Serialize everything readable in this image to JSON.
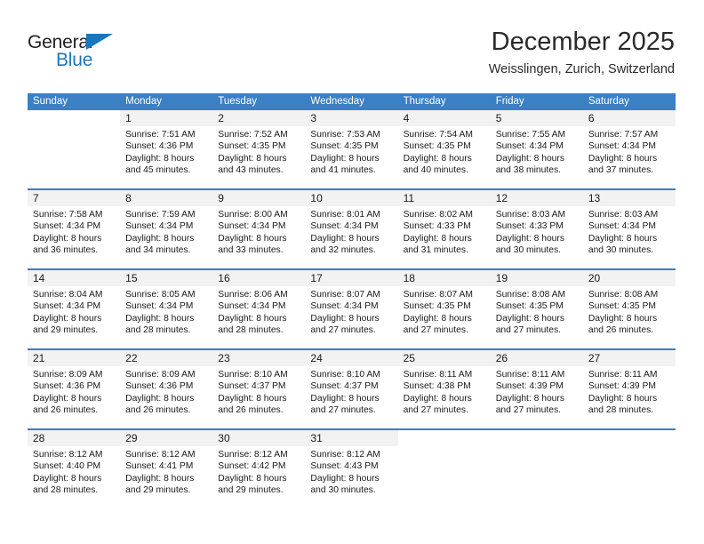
{
  "brand": {
    "name_part1": "General",
    "name_part2": "Blue",
    "triangle_color": "#1b76bc"
  },
  "header": {
    "title": "December 2025",
    "subtitle": "Weisslingen, Zurich, Switzerland"
  },
  "calendar": {
    "header_color": "#3b7fc4",
    "weekdays": [
      "Sunday",
      "Monday",
      "Tuesday",
      "Wednesday",
      "Thursday",
      "Friday",
      "Saturday"
    ],
    "weeks": [
      [
        {
          "day": ""
        },
        {
          "day": "1",
          "sunrise": "Sunrise: 7:51 AM",
          "sunset": "Sunset: 4:36 PM",
          "daylight_line1": "Daylight: 8 hours",
          "daylight_line2": "and 45 minutes."
        },
        {
          "day": "2",
          "sunrise": "Sunrise: 7:52 AM",
          "sunset": "Sunset: 4:35 PM",
          "daylight_line1": "Daylight: 8 hours",
          "daylight_line2": "and 43 minutes."
        },
        {
          "day": "3",
          "sunrise": "Sunrise: 7:53 AM",
          "sunset": "Sunset: 4:35 PM",
          "daylight_line1": "Daylight: 8 hours",
          "daylight_line2": "and 41 minutes."
        },
        {
          "day": "4",
          "sunrise": "Sunrise: 7:54 AM",
          "sunset": "Sunset: 4:35 PM",
          "daylight_line1": "Daylight: 8 hours",
          "daylight_line2": "and 40 minutes."
        },
        {
          "day": "5",
          "sunrise": "Sunrise: 7:55 AM",
          "sunset": "Sunset: 4:34 PM",
          "daylight_line1": "Daylight: 8 hours",
          "daylight_line2": "and 38 minutes."
        },
        {
          "day": "6",
          "sunrise": "Sunrise: 7:57 AM",
          "sunset": "Sunset: 4:34 PM",
          "daylight_line1": "Daylight: 8 hours",
          "daylight_line2": "and 37 minutes."
        }
      ],
      [
        {
          "day": "7",
          "sunrise": "Sunrise: 7:58 AM",
          "sunset": "Sunset: 4:34 PM",
          "daylight_line1": "Daylight: 8 hours",
          "daylight_line2": "and 36 minutes."
        },
        {
          "day": "8",
          "sunrise": "Sunrise: 7:59 AM",
          "sunset": "Sunset: 4:34 PM",
          "daylight_line1": "Daylight: 8 hours",
          "daylight_line2": "and 34 minutes."
        },
        {
          "day": "9",
          "sunrise": "Sunrise: 8:00 AM",
          "sunset": "Sunset: 4:34 PM",
          "daylight_line1": "Daylight: 8 hours",
          "daylight_line2": "and 33 minutes."
        },
        {
          "day": "10",
          "sunrise": "Sunrise: 8:01 AM",
          "sunset": "Sunset: 4:34 PM",
          "daylight_line1": "Daylight: 8 hours",
          "daylight_line2": "and 32 minutes."
        },
        {
          "day": "11",
          "sunrise": "Sunrise: 8:02 AM",
          "sunset": "Sunset: 4:33 PM",
          "daylight_line1": "Daylight: 8 hours",
          "daylight_line2": "and 31 minutes."
        },
        {
          "day": "12",
          "sunrise": "Sunrise: 8:03 AM",
          "sunset": "Sunset: 4:33 PM",
          "daylight_line1": "Daylight: 8 hours",
          "daylight_line2": "and 30 minutes."
        },
        {
          "day": "13",
          "sunrise": "Sunrise: 8:03 AM",
          "sunset": "Sunset: 4:34 PM",
          "daylight_line1": "Daylight: 8 hours",
          "daylight_line2": "and 30 minutes."
        }
      ],
      [
        {
          "day": "14",
          "sunrise": "Sunrise: 8:04 AM",
          "sunset": "Sunset: 4:34 PM",
          "daylight_line1": "Daylight: 8 hours",
          "daylight_line2": "and 29 minutes."
        },
        {
          "day": "15",
          "sunrise": "Sunrise: 8:05 AM",
          "sunset": "Sunset: 4:34 PM",
          "daylight_line1": "Daylight: 8 hours",
          "daylight_line2": "and 28 minutes."
        },
        {
          "day": "16",
          "sunrise": "Sunrise: 8:06 AM",
          "sunset": "Sunset: 4:34 PM",
          "daylight_line1": "Daylight: 8 hours",
          "daylight_line2": "and 28 minutes."
        },
        {
          "day": "17",
          "sunrise": "Sunrise: 8:07 AM",
          "sunset": "Sunset: 4:34 PM",
          "daylight_line1": "Daylight: 8 hours",
          "daylight_line2": "and 27 minutes."
        },
        {
          "day": "18",
          "sunrise": "Sunrise: 8:07 AM",
          "sunset": "Sunset: 4:35 PM",
          "daylight_line1": "Daylight: 8 hours",
          "daylight_line2": "and 27 minutes."
        },
        {
          "day": "19",
          "sunrise": "Sunrise: 8:08 AM",
          "sunset": "Sunset: 4:35 PM",
          "daylight_line1": "Daylight: 8 hours",
          "daylight_line2": "and 27 minutes."
        },
        {
          "day": "20",
          "sunrise": "Sunrise: 8:08 AM",
          "sunset": "Sunset: 4:35 PM",
          "daylight_line1": "Daylight: 8 hours",
          "daylight_line2": "and 26 minutes."
        }
      ],
      [
        {
          "day": "21",
          "sunrise": "Sunrise: 8:09 AM",
          "sunset": "Sunset: 4:36 PM",
          "daylight_line1": "Daylight: 8 hours",
          "daylight_line2": "and 26 minutes."
        },
        {
          "day": "22",
          "sunrise": "Sunrise: 8:09 AM",
          "sunset": "Sunset: 4:36 PM",
          "daylight_line1": "Daylight: 8 hours",
          "daylight_line2": "and 26 minutes."
        },
        {
          "day": "23",
          "sunrise": "Sunrise: 8:10 AM",
          "sunset": "Sunset: 4:37 PM",
          "daylight_line1": "Daylight: 8 hours",
          "daylight_line2": "and 26 minutes."
        },
        {
          "day": "24",
          "sunrise": "Sunrise: 8:10 AM",
          "sunset": "Sunset: 4:37 PM",
          "daylight_line1": "Daylight: 8 hours",
          "daylight_line2": "and 27 minutes."
        },
        {
          "day": "25",
          "sunrise": "Sunrise: 8:11 AM",
          "sunset": "Sunset: 4:38 PM",
          "daylight_line1": "Daylight: 8 hours",
          "daylight_line2": "and 27 minutes."
        },
        {
          "day": "26",
          "sunrise": "Sunrise: 8:11 AM",
          "sunset": "Sunset: 4:39 PM",
          "daylight_line1": "Daylight: 8 hours",
          "daylight_line2": "and 27 minutes."
        },
        {
          "day": "27",
          "sunrise": "Sunrise: 8:11 AM",
          "sunset": "Sunset: 4:39 PM",
          "daylight_line1": "Daylight: 8 hours",
          "daylight_line2": "and 28 minutes."
        }
      ],
      [
        {
          "day": "28",
          "sunrise": "Sunrise: 8:12 AM",
          "sunset": "Sunset: 4:40 PM",
          "daylight_line1": "Daylight: 8 hours",
          "daylight_line2": "and 28 minutes."
        },
        {
          "day": "29",
          "sunrise": "Sunrise: 8:12 AM",
          "sunset": "Sunset: 4:41 PM",
          "daylight_line1": "Daylight: 8 hours",
          "daylight_line2": "and 29 minutes."
        },
        {
          "day": "30",
          "sunrise": "Sunrise: 8:12 AM",
          "sunset": "Sunset: 4:42 PM",
          "daylight_line1": "Daylight: 8 hours",
          "daylight_line2": "and 29 minutes."
        },
        {
          "day": "31",
          "sunrise": "Sunrise: 8:12 AM",
          "sunset": "Sunset: 4:43 PM",
          "daylight_line1": "Daylight: 8 hours",
          "daylight_line2": "and 30 minutes."
        },
        {
          "day": ""
        },
        {
          "day": ""
        },
        {
          "day": ""
        }
      ]
    ]
  }
}
